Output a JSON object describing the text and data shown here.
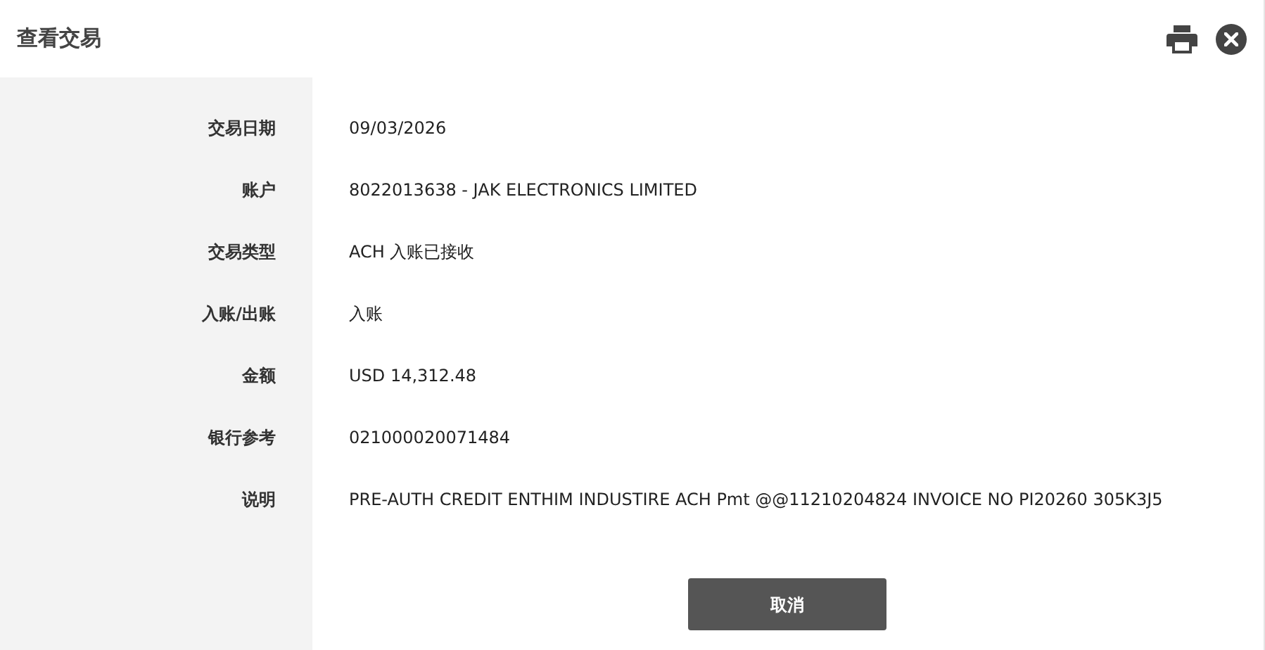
{
  "title": "查看交易",
  "fields": [
    {
      "label": "交易日期",
      "value": "09/03/2026"
    },
    {
      "label": "账户",
      "value": "8022013638 - JAK ELECTRONICS LIMITED"
    },
    {
      "label": "交易类型",
      "value": "ACH 入账已接收"
    },
    {
      "label": "入账/出账",
      "value": "入账"
    },
    {
      "label": "金额",
      "value": "USD 14,312.48"
    },
    {
      "label": "银行参考",
      "value": "021000020071484"
    },
    {
      "label": "说明",
      "value": "PRE-AUTH CREDIT ENTHIM INDUSTIRE ACH Pmt @@11210204824 INVOICE NO PI20260 305K3J5"
    }
  ],
  "cancel_button": "取消"
}
